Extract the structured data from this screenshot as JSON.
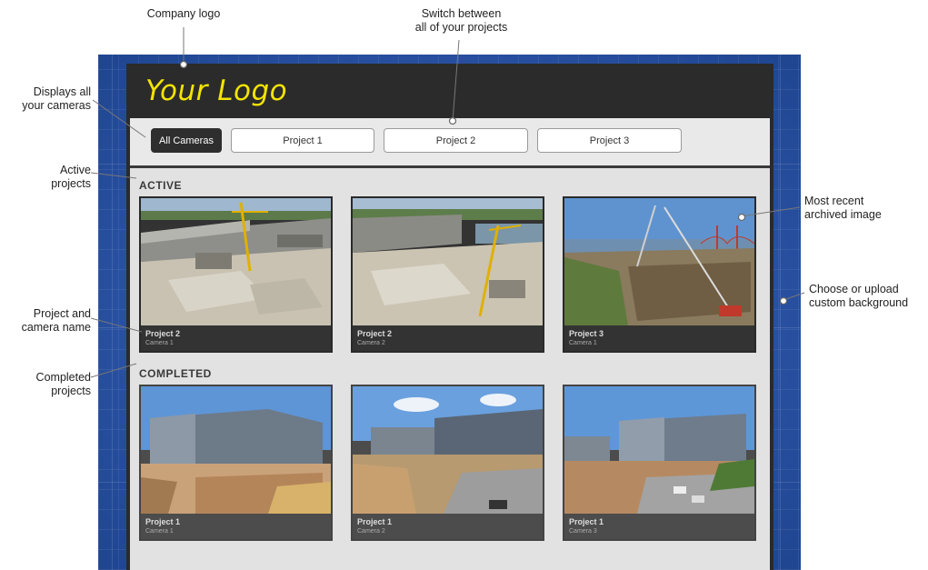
{
  "header": {
    "logo_text": "Your Logo"
  },
  "tabs": [
    {
      "label": "All Cameras",
      "active": true
    },
    {
      "label": "Project 1",
      "active": false
    },
    {
      "label": "Project 2",
      "active": false
    },
    {
      "label": "Project 3",
      "active": false
    }
  ],
  "sections": {
    "active_title": "ACTIVE",
    "completed_title": "COMPLETED"
  },
  "active_cards": [
    {
      "project": "Project 2",
      "camera": "Camera 1",
      "scene": "stadium"
    },
    {
      "project": "Project 2",
      "camera": "Camera 2",
      "scene": "stadium"
    },
    {
      "project": "Project 3",
      "camera": "Camera 1",
      "scene": "bridge-crane"
    }
  ],
  "completed_cards": [
    {
      "project": "Project 1",
      "camera": "Camera 1",
      "scene": "office-building"
    },
    {
      "project": "Project 1",
      "camera": "Camera 2",
      "scene": "office-building"
    },
    {
      "project": "Project 1",
      "camera": "Camera 3",
      "scene": "office-building"
    }
  ],
  "annotations": {
    "company_logo": "Company logo",
    "switch_projects_1": "Switch between",
    "switch_projects_2": "all of your projects",
    "displays_cameras_1": "Displays all",
    "displays_cameras_2": "your cameras",
    "active_projects_1": "Active",
    "active_projects_2": "projects",
    "most_recent_1": "Most recent",
    "most_recent_2": "archived image",
    "choose_bg_1": "Choose or upload",
    "choose_bg_2": "custom background",
    "project_camera_1": "Project and",
    "project_camera_2": "camera name",
    "completed_projects_1": "Completed",
    "completed_projects_2": "projects"
  },
  "colors": {
    "logo": "#f4e400",
    "frame": "#2b2b2b",
    "background": "#2b55a8",
    "active_tab": "#2e2e2e"
  }
}
